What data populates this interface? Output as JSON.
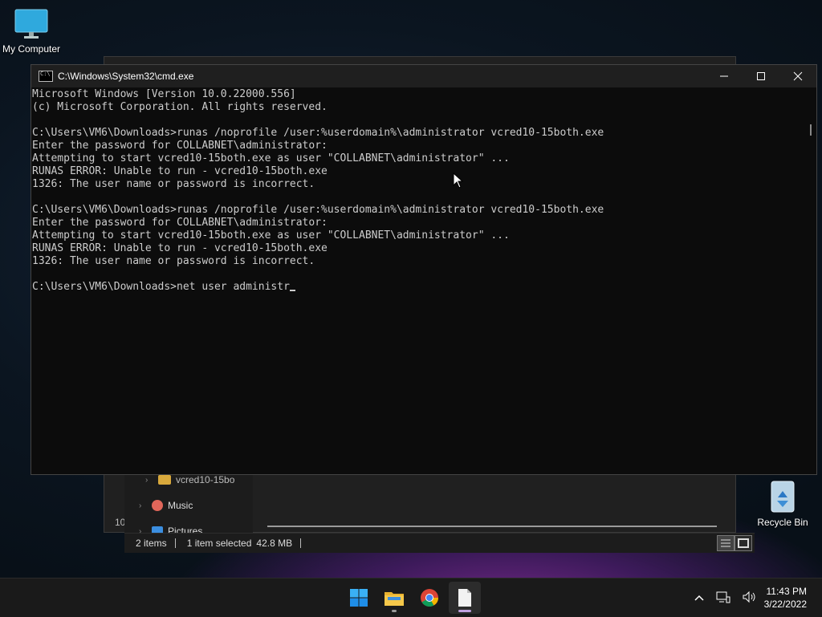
{
  "desktop": {
    "icons": [
      {
        "label": "My Computer"
      },
      {
        "label": "Recycle Bin"
      }
    ]
  },
  "explorer": {
    "nav_items": [
      {
        "label": "vcred10-15bo"
      },
      {
        "label": "Music"
      },
      {
        "label": "Pictures"
      }
    ],
    "partial_text": "10",
    "status": {
      "items_count": "2 items",
      "selection": "1 item selected",
      "size": "42.8 MB"
    }
  },
  "cmd": {
    "title": "C:\\Windows\\System32\\cmd.exe",
    "lines": [
      "Microsoft Windows [Version 10.0.22000.556]",
      "(c) Microsoft Corporation. All rights reserved.",
      "",
      "C:\\Users\\VM6\\Downloads>runas /noprofile /user:%userdomain%\\administrator vcred10-15both.exe",
      "Enter the password for COLLABNET\\administrator:",
      "Attempting to start vcred10-15both.exe as user \"COLLABNET\\administrator\" ...",
      "RUNAS ERROR: Unable to run - vcred10-15both.exe",
      "1326: The user name or password is incorrect.",
      "",
      "C:\\Users\\VM6\\Downloads>runas /noprofile /user:%userdomain%\\administrator vcred10-15both.exe",
      "Enter the password for COLLABNET\\administrator:",
      "Attempting to start vcred10-15both.exe as user \"COLLABNET\\administrator\" ...",
      "RUNAS ERROR: Unable to run - vcred10-15both.exe",
      "1326: The user name or password is incorrect.",
      ""
    ],
    "current_input": "C:\\Users\\VM6\\Downloads>net user administr"
  },
  "taskbar": {
    "apps": [
      "start-icon",
      "file-explorer-icon",
      "chrome-icon",
      "notepad-icon"
    ],
    "time": "11:43 PM",
    "date": "3/22/2022"
  }
}
